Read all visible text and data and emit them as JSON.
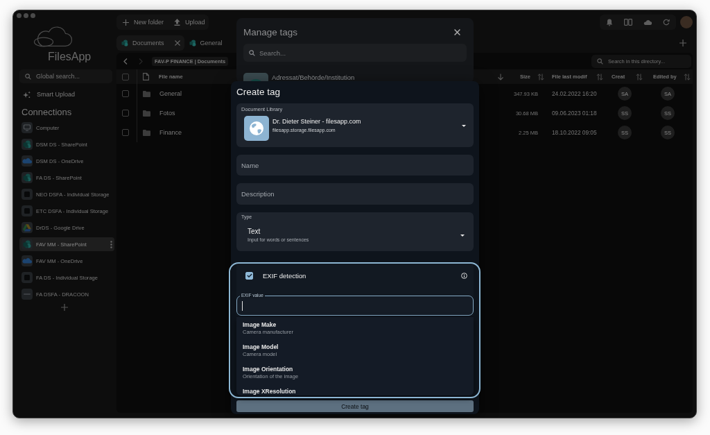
{
  "sidebar": {
    "logo_text": "FilesApp",
    "search": {
      "placeholder": "Global search..."
    },
    "smart_upload": "Smart Upload",
    "connections_title": "Connections",
    "connections": [
      {
        "name": "Computer",
        "kind": "computer",
        "selected": false
      },
      {
        "name": "DSM DS - SharePoint",
        "kind": "sharepoint",
        "selected": false
      },
      {
        "name": "DSM DS - OneDrive",
        "kind": "onedrive",
        "selected": false
      },
      {
        "name": "FA DS - SharePoint",
        "kind": "sharepoint",
        "selected": false
      },
      {
        "name": "NEO DSFA - Individual Storage",
        "kind": "storage",
        "selected": false
      },
      {
        "name": "ETC DSFA - Individual Storage",
        "kind": "storage",
        "selected": false
      },
      {
        "name": "DrDS - Google Drive",
        "kind": "googledrive",
        "selected": false
      },
      {
        "name": "FAV MM - SharePoint",
        "kind": "sharepoint",
        "selected": true
      },
      {
        "name": "FAV MM - OneDrive",
        "kind": "onedrive",
        "selected": false
      },
      {
        "name": "FA DS - Individual Storage",
        "kind": "storage",
        "selected": false
      },
      {
        "name": "FA DSFA - DRACOON",
        "kind": "dracoon",
        "selected": false
      }
    ]
  },
  "toolbar": [
    {
      "label": "New folder",
      "kind": "new_folder"
    },
    {
      "label": "Upload",
      "kind": "upload"
    }
  ],
  "tabs": [
    {
      "label": "Documents",
      "selected": true
    },
    {
      "label": "General",
      "selected": false
    }
  ],
  "history": {
    "can_go_back": true,
    "can_go_forward": false
  },
  "breadcrumb": "FAV-P FINANCE | Documents",
  "directory_search": {
    "placeholder": "Search in this directory..."
  },
  "table": {
    "select_all_checked": false,
    "columns": [
      {
        "label": "File name",
        "sorted": true
      },
      {
        "label": "Size",
        "sorted": false
      },
      {
        "label": "File last modif",
        "sorted": false
      },
      {
        "label": "Creat",
        "sorted": false
      },
      {
        "label": "Edited by",
        "sorted": false
      }
    ],
    "rows": [
      {
        "checked": false,
        "kind": "folder",
        "name": "General",
        "size": "347.93 KB",
        "modified": "24.02.2022 16:20",
        "created_by": "SA",
        "edited_by": "SA"
      },
      {
        "checked": false,
        "kind": "folder",
        "name": "Fotos",
        "size": "30.68 MB",
        "modified": "09.06.2023 01:18",
        "created_by": "SS",
        "edited_by": "SS"
      },
      {
        "checked": false,
        "kind": "folder",
        "name": "Finance",
        "size": "2.25 MB",
        "modified": "18.10.2022 09:05",
        "created_by": "SS",
        "edited_by": "SS"
      }
    ]
  },
  "manage_tags": {
    "title": "Manage tags",
    "search": {
      "placeholder": "Search..."
    },
    "tags": [
      {
        "name": "Adressat/Behörde/Institution"
      }
    ]
  },
  "create_tag": {
    "title": "Create tag",
    "document_library": {
      "label": "Document Library",
      "name": "Dr. Dieter Steiner - filesapp.com",
      "address": "filesapp.storage.filesapp.com"
    },
    "name_field": {
      "placeholder": "Name"
    },
    "description_field": {
      "placeholder": "Description"
    },
    "type": {
      "label": "Type",
      "value": "Text",
      "description": "Input for words or sentences"
    },
    "exif": {
      "label": "EXIF detection",
      "checked": true,
      "field": {
        "label": "EXIF value",
        "focused": true
      },
      "options": [
        {
          "title": "Image Make",
          "description": "Camera manufacturer"
        },
        {
          "title": "Image Model",
          "description": "Camera model"
        },
        {
          "title": "Image Orientation",
          "description": "Orientation of the image"
        },
        {
          "title": "Image XResolution"
        }
      ]
    },
    "submit": {
      "label": "Create tag",
      "disabled": true
    }
  }
}
